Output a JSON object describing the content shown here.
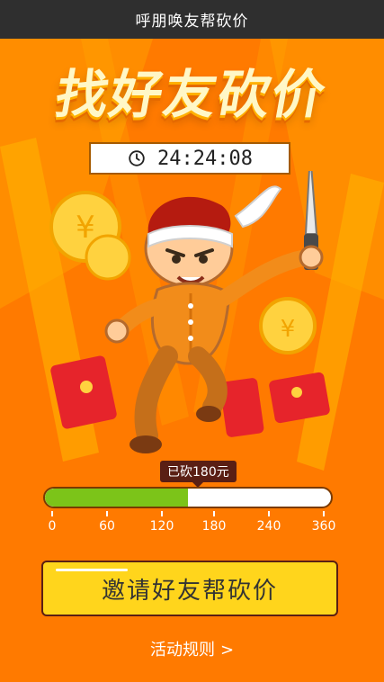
{
  "topbar": {
    "title": "呼朋唤友帮砍价"
  },
  "hero": {
    "title": "找好友砍价"
  },
  "timer": {
    "value": "24:24:08",
    "icon": "clock-icon"
  },
  "progress": {
    "badge_text": "已砍180元",
    "current": 180,
    "max": 360,
    "ticks": [
      "0",
      "60",
      "120",
      "180",
      "240",
      "360"
    ]
  },
  "cta": {
    "label": "邀请好友帮砍价"
  },
  "rules": {
    "label": "活动规则",
    "chevron": ">"
  },
  "colors": {
    "topbar": "#2f2f2f",
    "background": "#ff7a00",
    "cta": "#ffd51c",
    "progress": "#7cc419",
    "badge": "#5a1f14"
  }
}
